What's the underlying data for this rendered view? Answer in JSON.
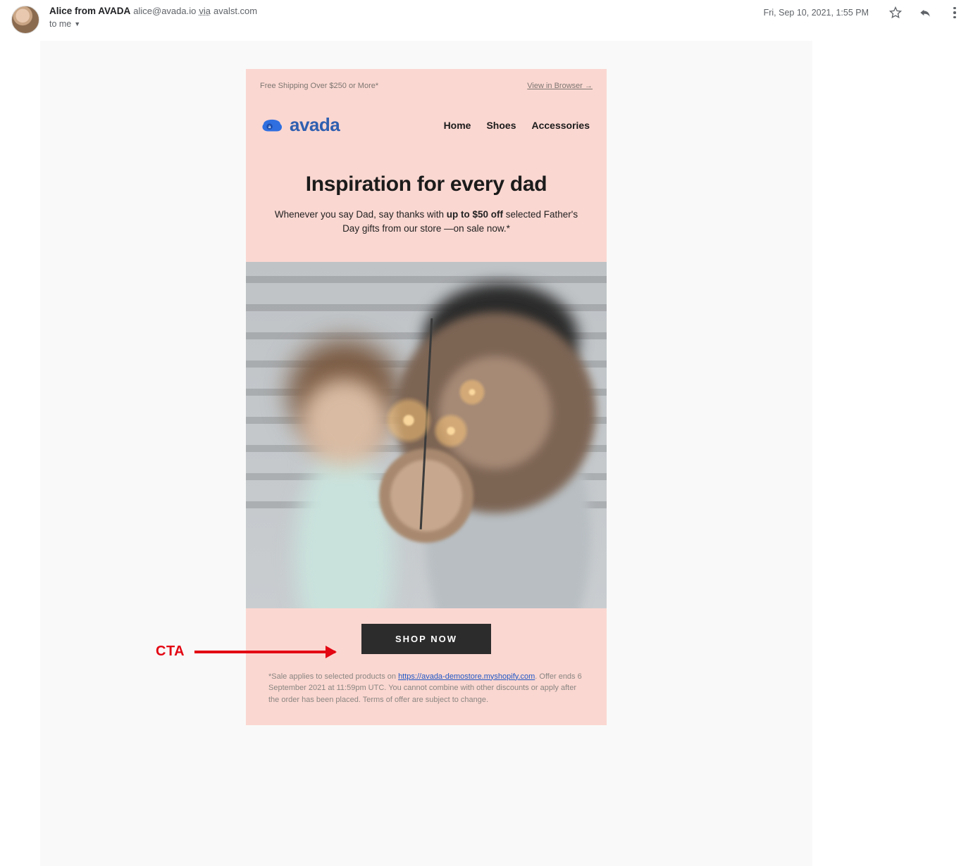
{
  "gmail": {
    "sender_name": "Alice from AVADA",
    "sender_email": "alice@avada.io",
    "via_word": "via",
    "via_domain": "avalst.com",
    "recipient_line": "to me",
    "timestamp": "Fri, Sep 10, 2021, 1:55 PM"
  },
  "email": {
    "top_left": "Free Shipping Over $250 or More*",
    "top_right": "View in Browser →",
    "brand_text": "avada",
    "nav": {
      "home": "Home",
      "shoes": "Shoes",
      "accessories": "Accessories"
    },
    "hero_title": "Inspiration for every dad",
    "hero_sub_prefix": "Whenever you say Dad, say thanks with ",
    "hero_sub_bold": "up to $50 off",
    "hero_sub_suffix": " selected Father's Day gifts from our store —on sale now.*",
    "cta_label": "SHOP NOW",
    "fine_prefix": "*Sale applies to selected products on ",
    "fine_link": "https://avada-demostore.myshopify.com",
    "fine_suffix": ". Offer ends 6 September 2021 at 11:59pm UTC. You cannot combine with other discounts or apply after the order has been placed. Terms of offer are subject to change."
  },
  "annotation": {
    "label": "CTA"
  }
}
